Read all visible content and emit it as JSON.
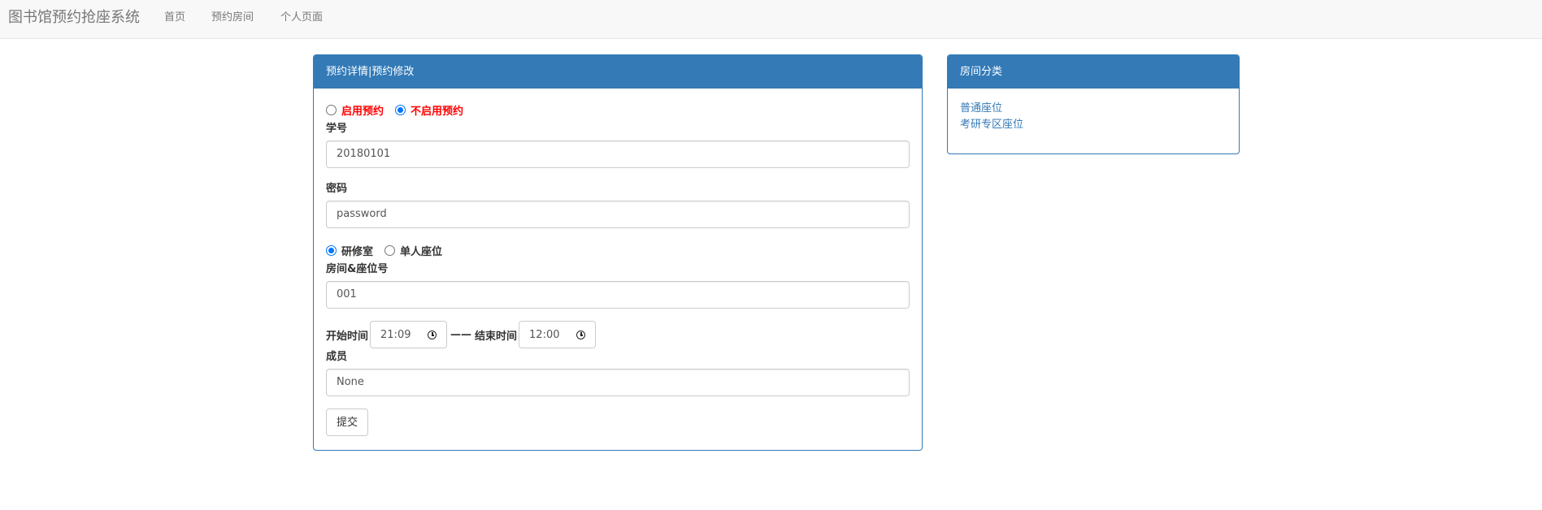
{
  "navbar": {
    "brand": "图书馆预约抢座系统",
    "links": [
      "首页",
      "预约房间",
      "个人页面"
    ]
  },
  "form_panel": {
    "heading": "预约详情|预约修改",
    "enable_options": {
      "enable_label": "启用预约",
      "disable_label": "不启用预约",
      "selected": "不启用预约"
    },
    "student_id": {
      "label": "学号",
      "value": "20180101"
    },
    "password": {
      "label": "密码",
      "value": "password"
    },
    "room_type_options": {
      "study_room_label": "研修室",
      "single_seat_label": "单人座位",
      "selected": "研修室"
    },
    "room_seat": {
      "label": "房间&座位号",
      "value": "001"
    },
    "time": {
      "start_label": "开始时间",
      "start_value": "21:09",
      "separator": "——",
      "end_label": "结束时间",
      "end_value": "12:00"
    },
    "members": {
      "label": "成员",
      "value": "None"
    },
    "submit_label": "提交"
  },
  "category_panel": {
    "heading": "房间分类",
    "items": [
      "普通座位",
      "考研专区座位"
    ]
  },
  "colors": {
    "primary": "#337ab7",
    "navbar_bg": "#f8f8f8",
    "warning_red": "#ff0000",
    "radio_blue": "#0075ff"
  }
}
